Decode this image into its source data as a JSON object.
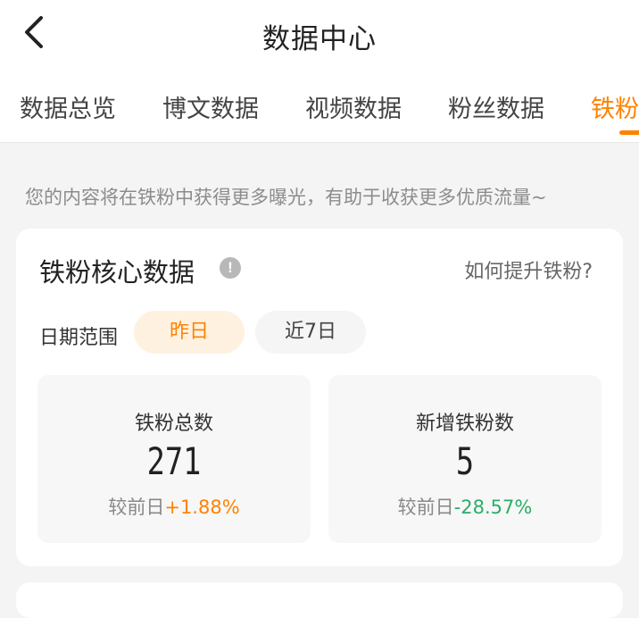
{
  "header": {
    "title": "数据中心",
    "back_icon": "chevron-left-icon"
  },
  "tabs": [
    {
      "label": "数据总览",
      "active": false
    },
    {
      "label": "博文数据",
      "active": false
    },
    {
      "label": "视频数据",
      "active": false
    },
    {
      "label": "粉丝数据",
      "active": false
    },
    {
      "label": "铁粉",
      "active": true
    }
  ],
  "tip": "您的内容将在铁粉中获得更多曝光，有助于收获更多优质流量~",
  "core_card": {
    "title": "铁粉核心数据",
    "info_icon": "!",
    "help_link": "如何提升铁粉?",
    "date_range": {
      "label": "日期范围",
      "options": [
        "昨日",
        "近7日"
      ],
      "selected": "昨日"
    },
    "stats": [
      {
        "label": "铁粉总数",
        "value": "271",
        "compare_prefix": "较前日",
        "change": "+1.88%",
        "trend": "up"
      },
      {
        "label": "新增铁粉数",
        "value": "5",
        "compare_prefix": "较前日",
        "change": "-28.57%",
        "trend": "down"
      }
    ]
  },
  "colors": {
    "accent": "#ff8200",
    "positive": "#ff8200",
    "negative": "#2aae67",
    "background": "#f4f4f4"
  }
}
